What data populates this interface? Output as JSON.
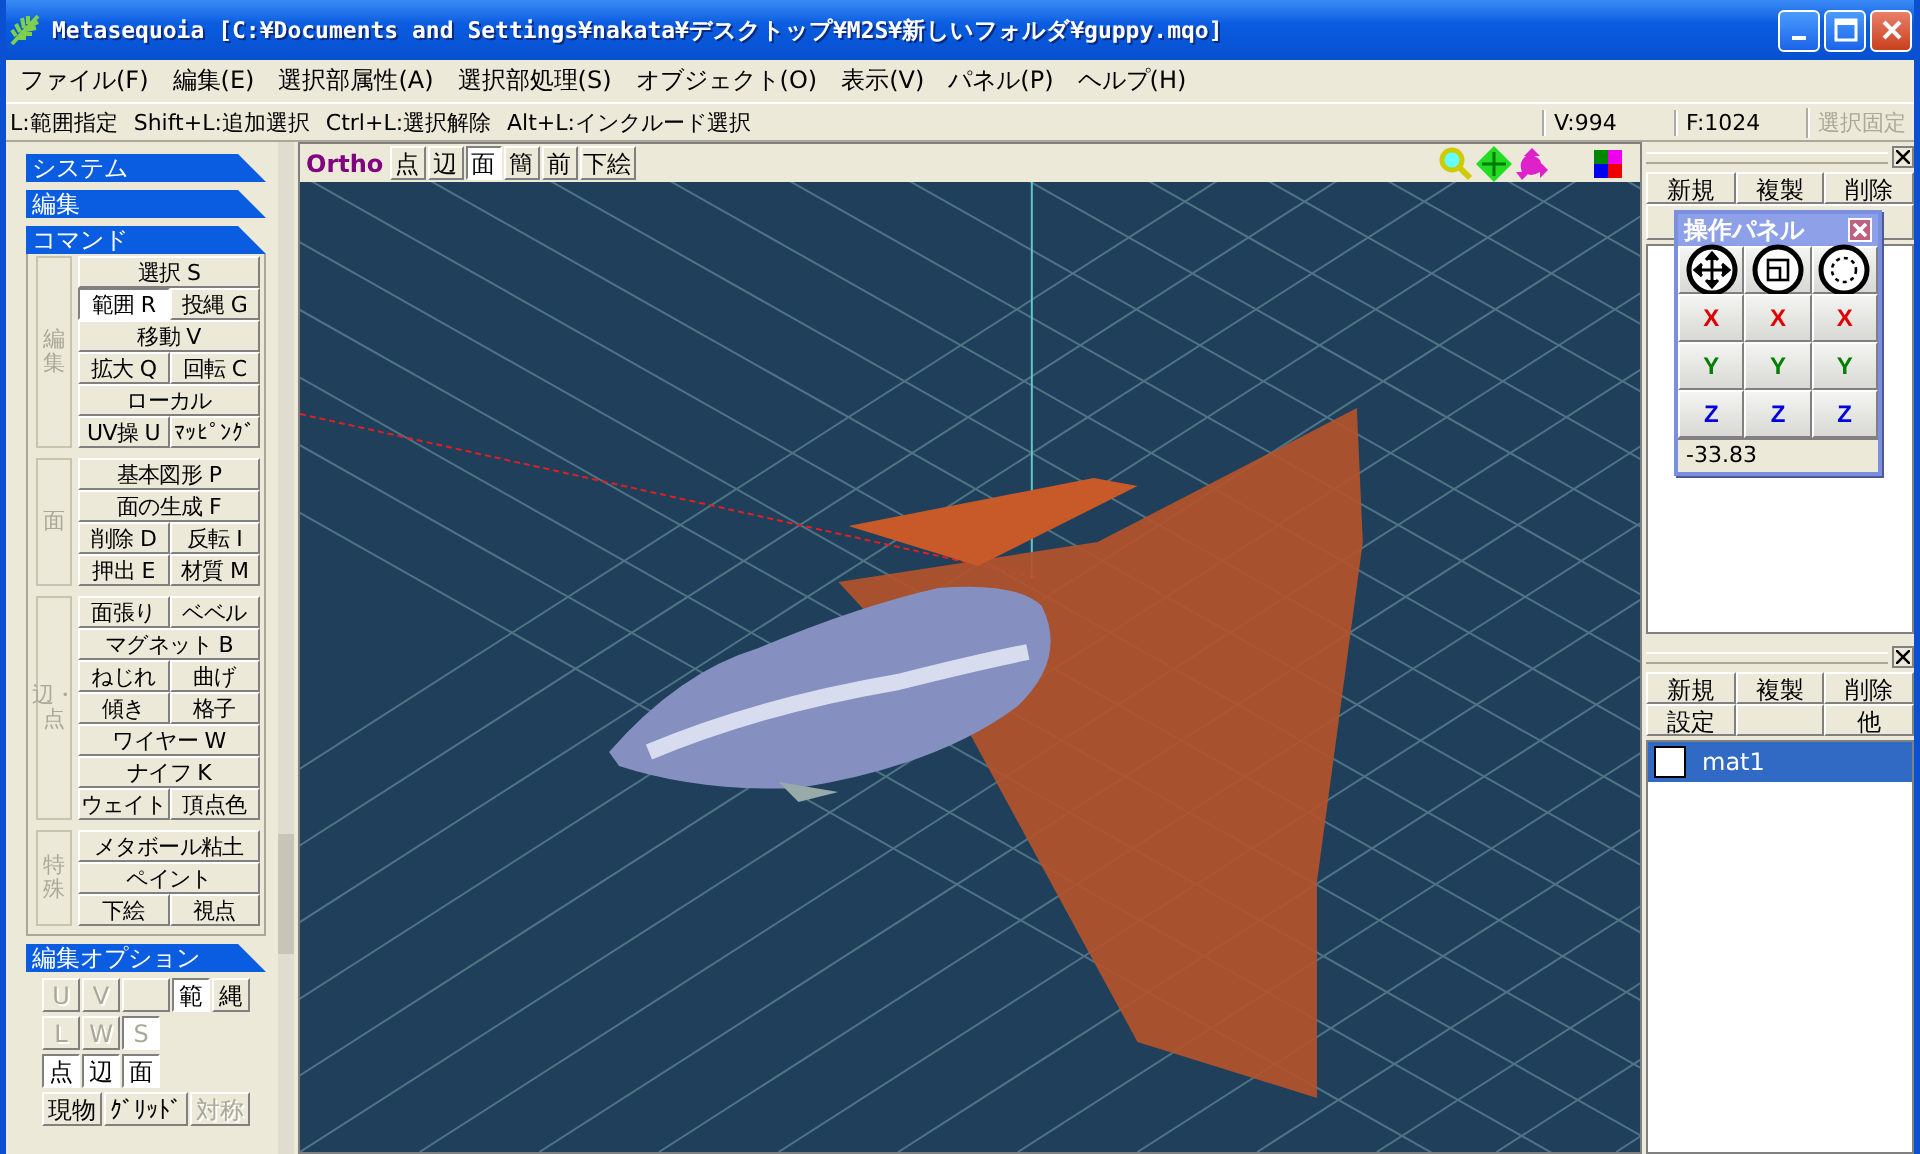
{
  "window": {
    "title": "Metasequoia [C:¥Documents and Settings¥nakata¥デスクトップ¥M2S¥新しいフォルダ¥guppy.mqo]"
  },
  "menu": [
    "ファイル(F)",
    "編集(E)",
    "選択部属性(A)",
    "選択部処理(S)",
    "オブジェクト(O)",
    "表示(V)",
    "パネル(P)",
    "ヘルプ(H)"
  ],
  "hint_bar": {
    "hints": [
      "L:範囲指定",
      "Shift+L:追加選択",
      "Ctrl+L:選択解除",
      "Alt+L:インクルード選択"
    ],
    "vertex_count": "V:994",
    "face_count": "F:1024",
    "lock_button": {
      "label": "選択固定",
      "disabled": true
    }
  },
  "left_panel": {
    "sections": [
      "システム",
      "編集",
      "コマンド"
    ],
    "groups": [
      {
        "label": "編集",
        "rows": [
          [
            {
              "label": "選択 S",
              "selected": false
            }
          ],
          [
            {
              "label": "範囲 R",
              "selected": true
            },
            {
              "label": "投縄 G",
              "selected": false
            }
          ],
          [
            {
              "label": "移動 V",
              "selected": false
            }
          ],
          [
            {
              "label": "拡大 Q",
              "selected": false
            },
            {
              "label": "回転 C",
              "selected": false
            }
          ],
          [
            {
              "label": "ローカル",
              "selected": false
            }
          ],
          [
            {
              "label": "UV操 U",
              "selected": false
            },
            {
              "label": "ﾏｯﾋﾟﾝｸﾞ",
              "selected": false
            }
          ]
        ]
      },
      {
        "label": "面",
        "rows": [
          [
            {
              "label": "基本図形 P",
              "selected": false
            }
          ],
          [
            {
              "label": "面の生成 F",
              "selected": false
            }
          ],
          [
            {
              "label": "削除 D",
              "selected": false
            },
            {
              "label": "反転 I",
              "selected": false
            }
          ],
          [
            {
              "label": "押出 E",
              "selected": false
            },
            {
              "label": "材質 M",
              "selected": false
            }
          ]
        ]
      },
      {
        "label": "辺・点",
        "rows": [
          [
            {
              "label": "面張り",
              "selected": false
            },
            {
              "label": "ベベル",
              "selected": false
            }
          ],
          [
            {
              "label": "マグネット B",
              "selected": false
            }
          ],
          [
            {
              "label": "ねじれ",
              "selected": false
            },
            {
              "label": "曲げ",
              "selected": false
            }
          ],
          [
            {
              "label": "傾き",
              "selected": false
            },
            {
              "label": "格子",
              "selected": false
            }
          ],
          [
            {
              "label": "ワイヤー W",
              "selected": false
            }
          ],
          [
            {
              "label": "ナイフ K",
              "selected": false
            }
          ],
          [
            {
              "label": "ウェイト",
              "selected": false
            },
            {
              "label": "頂点色",
              "selected": false
            }
          ]
        ]
      },
      {
        "label": "特殊",
        "rows": [
          [
            {
              "label": "メタボール粘土",
              "selected": false
            }
          ],
          [
            {
              "label": "ペイント",
              "selected": false
            }
          ],
          [
            {
              "label": "下絵",
              "selected": false
            },
            {
              "label": "視点",
              "selected": false
            }
          ]
        ]
      }
    ],
    "options": {
      "title": "編集オプション",
      "option_sets": [
        {
          "buttons": [
            {
              "kind": "button",
              "label": "U",
              "selected": false,
              "disabled": true
            },
            {
              "kind": "button",
              "label": "V",
              "selected": false,
              "disabled": true
            },
            {
              "kind": "blank"
            },
            {
              "kind": "button",
              "label": "範",
              "selected": true,
              "disabled": false
            },
            {
              "kind": "button",
              "label": "縄",
              "selected": false,
              "disabled": false
            }
          ]
        },
        {
          "buttons": [
            {
              "kind": "button",
              "label": "L",
              "selected": false,
              "disabled": true
            },
            {
              "kind": "button",
              "label": "W",
              "selected": false,
              "disabled": true
            },
            {
              "kind": "button",
              "label": "S",
              "selected": true,
              "disabled": true
            }
          ]
        },
        {
          "buttons": [
            {
              "kind": "button",
              "label": "点",
              "selected": true,
              "disabled": false
            },
            {
              "kind": "button",
              "label": "辺",
              "selected": true,
              "disabled": false
            },
            {
              "kind": "button",
              "label": "面",
              "selected": true,
              "disabled": false
            }
          ]
        },
        {
          "buttons": [
            {
              "kind": "button",
              "label": "現物",
              "selected": false,
              "disabled": false
            },
            {
              "kind": "button",
              "label": "ｸﾞﾘｯﾄﾞ",
              "selected": false,
              "disabled": false
            },
            {
              "kind": "button",
              "label": "対称",
              "selected": false,
              "disabled": true
            }
          ]
        }
      ]
    }
  },
  "viewport": {
    "mode_label": "Ortho",
    "buttons": [
      {
        "label": "点",
        "selected": false
      },
      {
        "label": "辺",
        "selected": false
      },
      {
        "label": "面",
        "selected": true
      },
      {
        "label": "簡",
        "selected": false
      },
      {
        "label": "前",
        "selected": false
      },
      {
        "label": "下絵",
        "selected": false
      }
    ]
  },
  "object_panel": {
    "buttons": [
      "新規",
      "複製",
      "削除"
    ]
  },
  "operation_panel": {
    "title": "操作パネル",
    "axis_rows": [
      {
        "labels": [
          "X",
          "X",
          "X"
        ],
        "color": "#e00000"
      },
      {
        "labels": [
          "Y",
          "Y",
          "Y"
        ],
        "color": "#008000"
      },
      {
        "labels": [
          "Z",
          "Z",
          "Z"
        ],
        "color": "#0000e0"
      }
    ],
    "value": "-33.83"
  },
  "material_panel": {
    "buttons": [
      [
        {
          "kind": "button",
          "label": "新規"
        },
        {
          "kind": "button",
          "label": "複製"
        },
        {
          "kind": "button",
          "label": "削除"
        }
      ],
      [
        {
          "kind": "button",
          "label": "設定"
        },
        {
          "kind": "blank"
        },
        {
          "kind": "button",
          "label": "他"
        }
      ]
    ],
    "materials": [
      {
        "name": "mat1",
        "selected": true,
        "color": "#ffffff"
      }
    ]
  }
}
